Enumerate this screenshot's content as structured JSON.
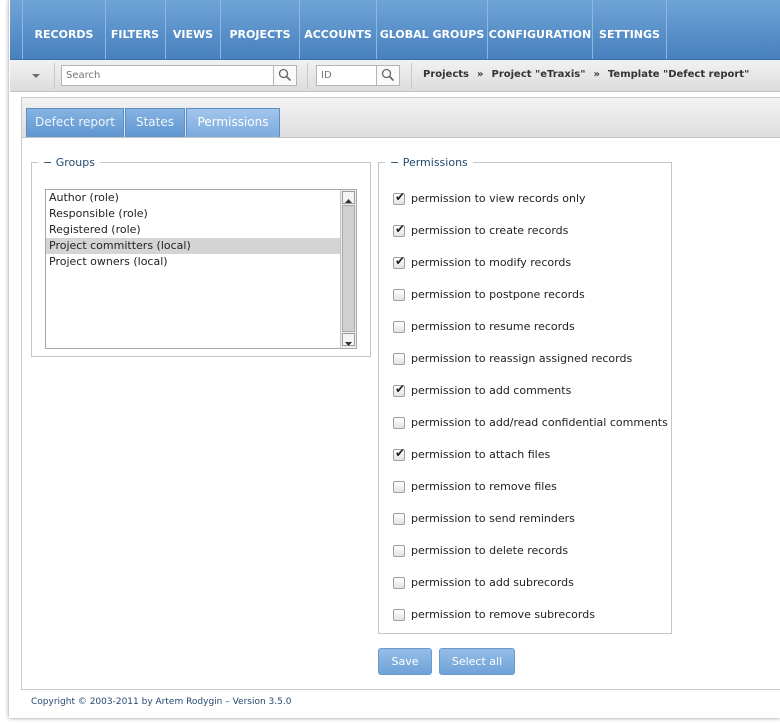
{
  "nav": {
    "items": [
      "RECORDS",
      "FILTERS",
      "VIEWS",
      "PROJECTS",
      "ACCOUNTS",
      "GLOBAL GROUPS",
      "CONFIGURATION",
      "SETTINGS"
    ]
  },
  "toolbar": {
    "search_placeholder": "Search",
    "id_placeholder": "ID",
    "breadcrumb": [
      "Projects",
      "Project \"eTraxis\"",
      "Template \"Defect report\""
    ],
    "breadcrumb_sep": "»"
  },
  "tabs": [
    {
      "label": "Defect report",
      "active": false
    },
    {
      "label": "States",
      "active": false
    },
    {
      "label": "Permissions",
      "active": true
    }
  ],
  "groups": {
    "legend": "− Groups",
    "items": [
      {
        "label": "Author (role)",
        "selected": false
      },
      {
        "label": "Responsible (role)",
        "selected": false
      },
      {
        "label": "Registered (role)",
        "selected": false
      },
      {
        "label": "Project committers (local)",
        "selected": true
      },
      {
        "label": "Project owners (local)",
        "selected": false
      }
    ]
  },
  "permissions": {
    "legend": "− Permissions",
    "items": [
      {
        "label": "permission to view records only",
        "checked": true
      },
      {
        "label": "permission to create records",
        "checked": true
      },
      {
        "label": "permission to modify records",
        "checked": true
      },
      {
        "label": "permission to postpone records",
        "checked": false
      },
      {
        "label": "permission to resume records",
        "checked": false
      },
      {
        "label": "permission to reassign assigned records",
        "checked": false
      },
      {
        "label": "permission to add comments",
        "checked": true
      },
      {
        "label": "permission to add/read confidential comments",
        "checked": false
      },
      {
        "label": "permission to attach files",
        "checked": true
      },
      {
        "label": "permission to remove files",
        "checked": false
      },
      {
        "label": "permission to send reminders",
        "checked": false
      },
      {
        "label": "permission to delete records",
        "checked": false
      },
      {
        "label": "permission to add subrecords",
        "checked": false
      },
      {
        "label": "permission to remove subrecords",
        "checked": false
      }
    ]
  },
  "buttons": {
    "save": "Save",
    "select_all": "Select all"
  },
  "footer": "Copyright © 2003-2011 by Artem Rodygin – Version 3.5.0",
  "icons": {
    "search": "magnifier-icon",
    "dropdown": "chevron-down-icon"
  },
  "colors": {
    "accent": "#5b8ec6",
    "link": "#23496f"
  }
}
